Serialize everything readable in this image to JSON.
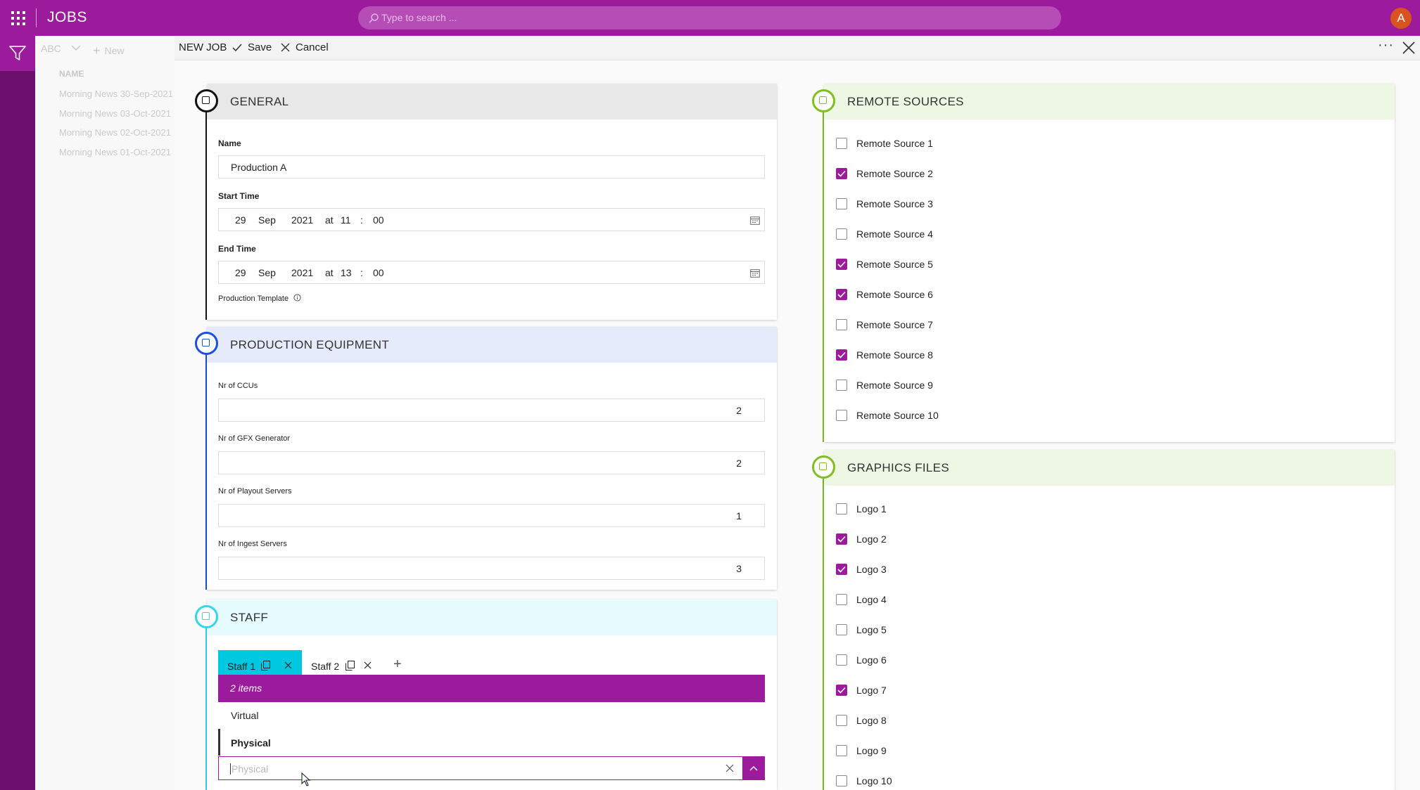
{
  "app": {
    "title": "JOBS",
    "search_placeholder": "Type to search ...",
    "avatar_initial": "A",
    "brand_color": "#9c1b9c"
  },
  "list_panel": {
    "view_label": "ABC",
    "new_label": "New",
    "column_header": "NAME",
    "items": [
      "Morning News 30-Sep-2021",
      "Morning News 03-Oct-2021",
      "Morning News 02-Oct-2021",
      "Morning News 01-Oct-2021"
    ]
  },
  "commands": {
    "new_job": "NEW JOB",
    "save": "Save",
    "cancel": "Cancel",
    "more": "···"
  },
  "general": {
    "title": "GENERAL",
    "name_label": "Name",
    "name_value": "Production A",
    "start_label": "Start Time",
    "start": {
      "day": "29",
      "month": "Sep",
      "year": "2021",
      "at": "at",
      "hour": "11",
      "sep": ":",
      "minute": "00"
    },
    "end_label": "End Time",
    "end": {
      "day": "29",
      "month": "Sep",
      "year": "2021",
      "at": "at",
      "hour": "13",
      "sep": ":",
      "minute": "00"
    },
    "template_label": "Production Template",
    "color": "#111111"
  },
  "equipment": {
    "title": "PRODUCTION EQUIPMENT",
    "color": "#1c4fe0",
    "fields": [
      {
        "label": "Nr of CCUs",
        "value": "2"
      },
      {
        "label": "Nr of GFX Generator",
        "value": "2"
      },
      {
        "label": "Nr of Playout Servers",
        "value": "1"
      },
      {
        "label": "Nr of Ingest Servers",
        "value": "3"
      }
    ]
  },
  "staff": {
    "title": "STAFF",
    "color": "#33d6ea",
    "tabs": [
      {
        "label": "Staff 1",
        "active": true
      },
      {
        "label": "Staff 2",
        "active": false
      }
    ],
    "add_label": "+",
    "dropdown_header": "2 items",
    "options": [
      "Virtual",
      "Physical"
    ],
    "selected": "Physical",
    "input_placeholder": "Physical"
  },
  "remote_sources": {
    "title": "REMOTE SOURCES",
    "color": "#7fbf1f",
    "items": [
      {
        "label": "Remote Source 1",
        "checked": false
      },
      {
        "label": "Remote Source 2",
        "checked": true
      },
      {
        "label": "Remote Source 3",
        "checked": false
      },
      {
        "label": "Remote Source 4",
        "checked": false
      },
      {
        "label": "Remote Source 5",
        "checked": true
      },
      {
        "label": "Remote Source 6",
        "checked": true
      },
      {
        "label": "Remote Source 7",
        "checked": false
      },
      {
        "label": "Remote Source 8",
        "checked": true
      },
      {
        "label": "Remote Source 9",
        "checked": false
      },
      {
        "label": "Remote Source 10",
        "checked": false
      }
    ]
  },
  "graphics_files": {
    "title": "GRAPHICS FILES",
    "color": "#7fbf1f",
    "items": [
      {
        "label": "Logo 1",
        "checked": false
      },
      {
        "label": "Logo 2",
        "checked": true
      },
      {
        "label": "Logo 3",
        "checked": true
      },
      {
        "label": "Logo 4",
        "checked": false
      },
      {
        "label": "Logo 5",
        "checked": false
      },
      {
        "label": "Logo 6",
        "checked": false
      },
      {
        "label": "Logo 7",
        "checked": true
      },
      {
        "label": "Logo 8",
        "checked": false
      },
      {
        "label": "Logo 9",
        "checked": false
      },
      {
        "label": "Logo 10",
        "checked": false
      }
    ]
  }
}
